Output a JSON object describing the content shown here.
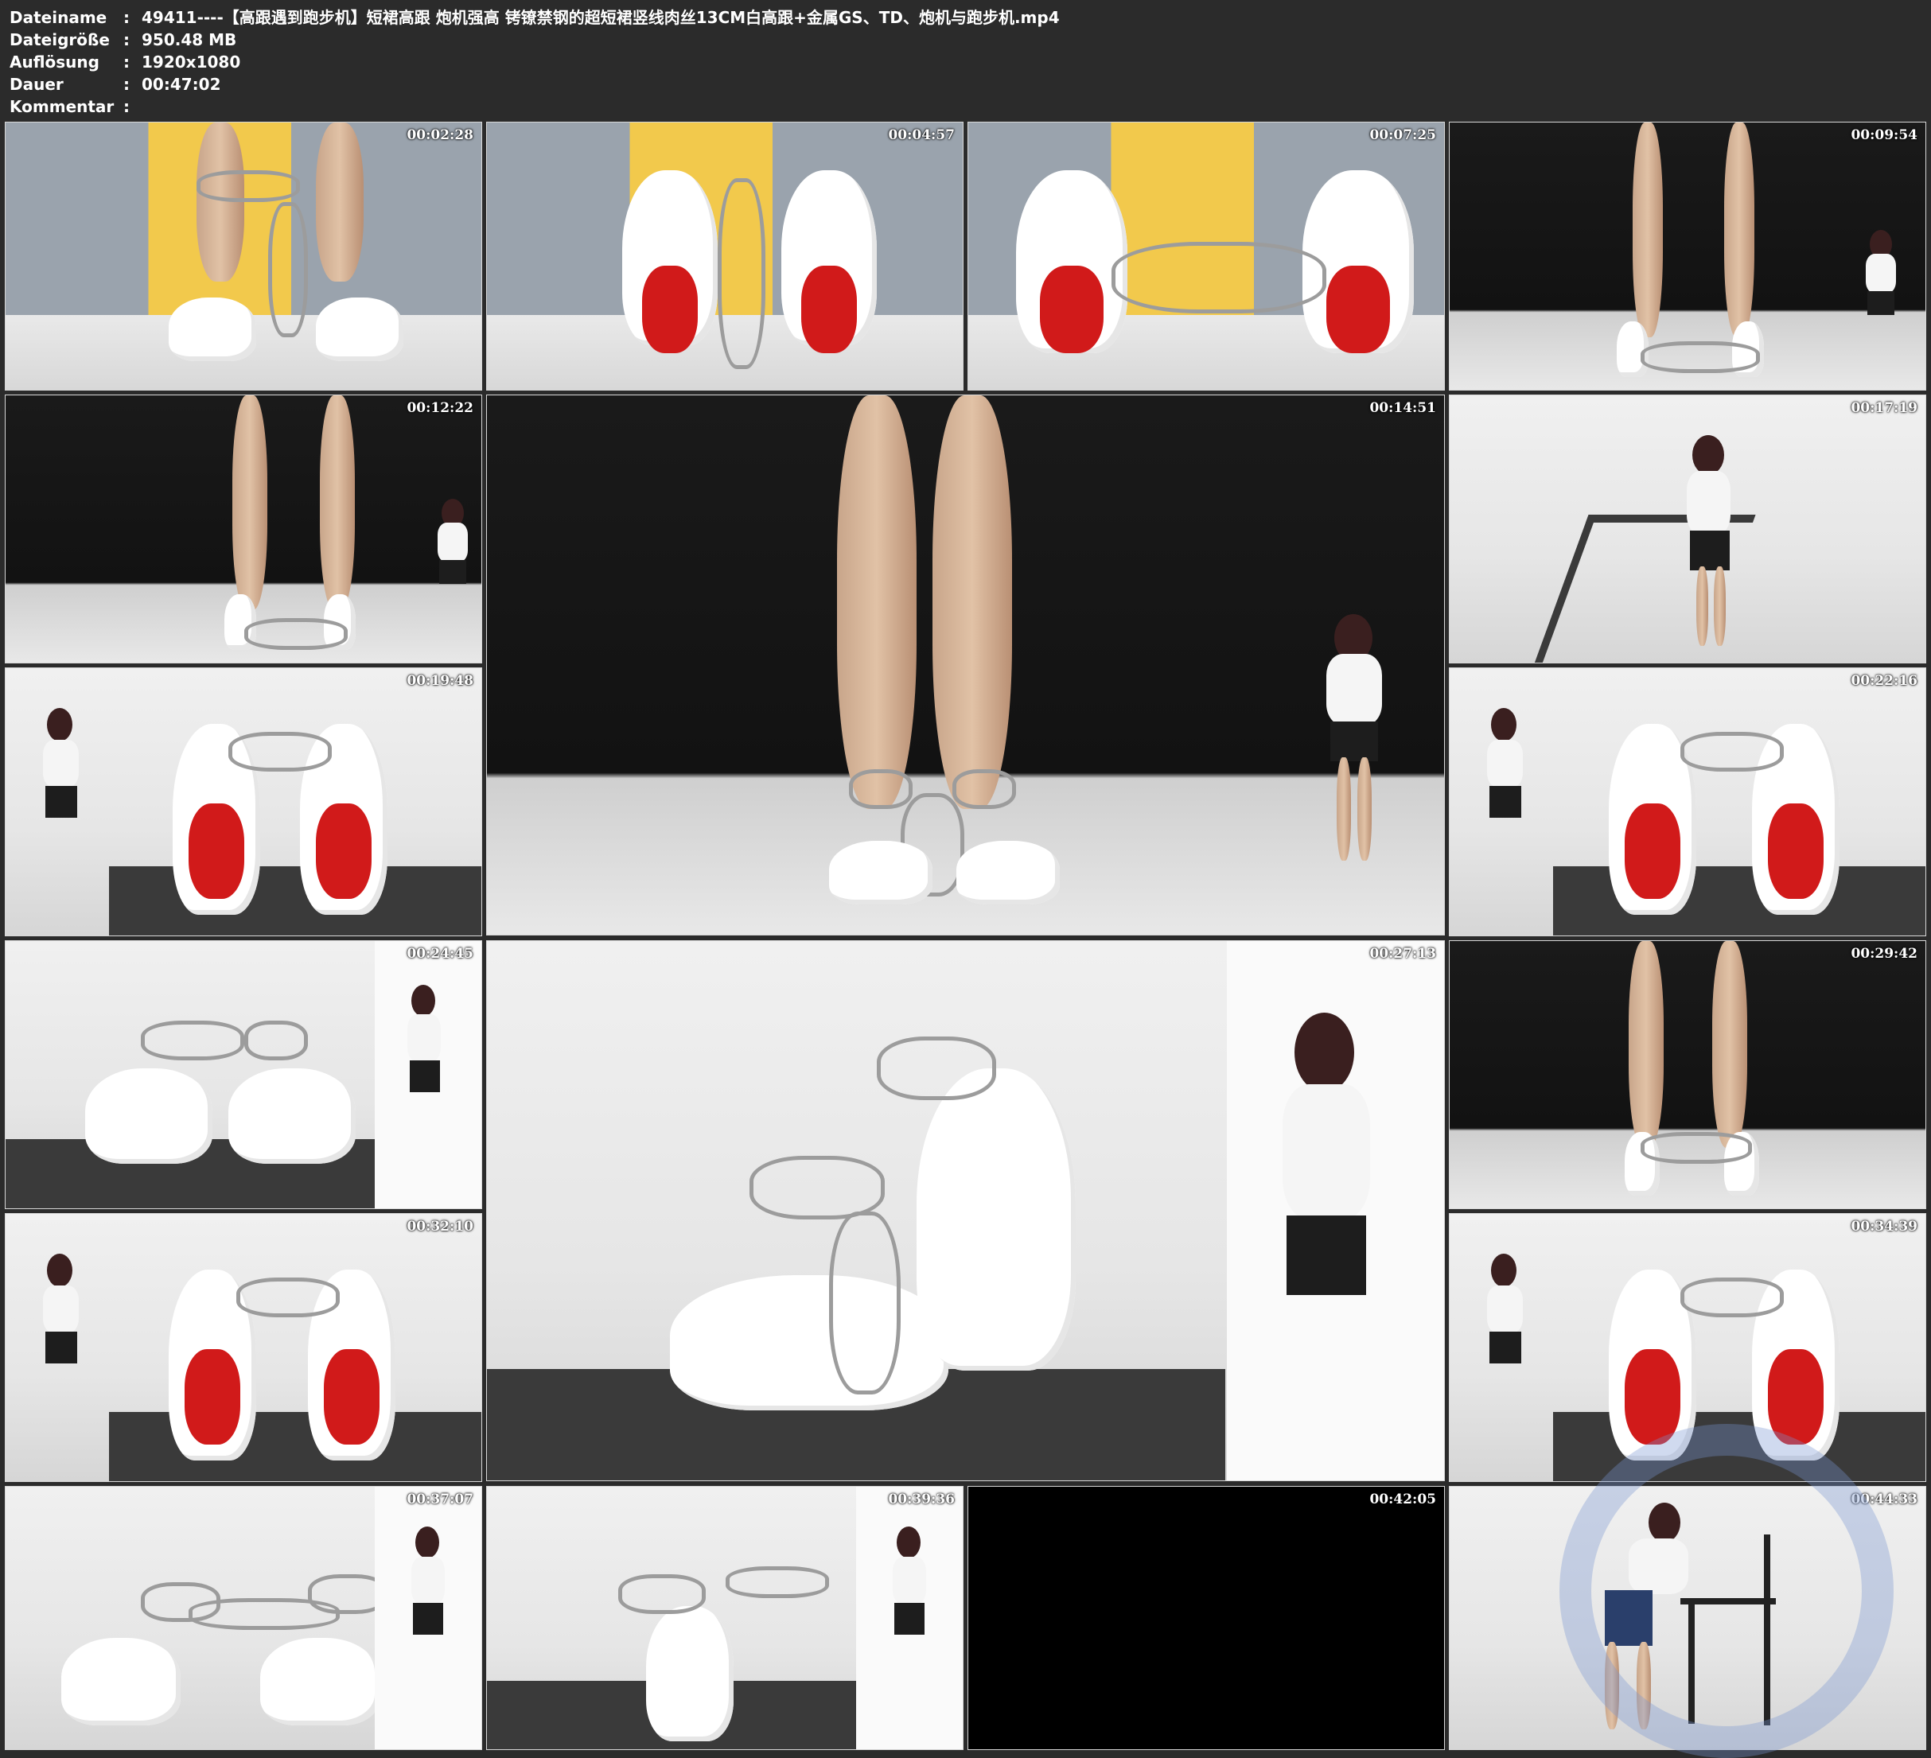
{
  "info": {
    "rows": [
      {
        "label": "Dateiname",
        "value": "49411----【高跟遇到跑步机】短裙高跟 炮机强高 铐镣禁钢的超短裙竖线肉丝13CM白高跟+金属GS、TD、炮机与跑步机.mp4"
      },
      {
        "label": "Dateigröße",
        "value": "950.48 MB"
      },
      {
        "label": "Auflösung",
        "value": "1920x1080"
      },
      {
        "label": "Dauer",
        "value": "00:47:02"
      },
      {
        "label": "Kommentar",
        "value": ""
      }
    ],
    "colon": ":"
  },
  "thumbnails": [
    {
      "time": "00:02:28",
      "scene": "yellow-shoes"
    },
    {
      "time": "00:04:57",
      "scene": "yellow-heels-back"
    },
    {
      "time": "00:07:25",
      "scene": "yellow-heels-back"
    },
    {
      "time": "00:09:54",
      "scene": "dark-legs"
    },
    {
      "time": "00:12:22",
      "scene": "dark-legs"
    },
    {
      "time": "00:14:51",
      "scene": "dark-legs-large"
    },
    {
      "time": "00:17:19",
      "scene": "light-treadmill"
    },
    {
      "time": "00:19:48",
      "scene": "treadmill-heels"
    },
    {
      "time": "00:22:16",
      "scene": "treadmill-heels"
    },
    {
      "time": "00:24:45",
      "scene": "treadmill-shoes"
    },
    {
      "time": "00:27:13",
      "scene": "treadmill-large"
    },
    {
      "time": "00:29:42",
      "scene": "dark-legs"
    },
    {
      "time": "00:32:10",
      "scene": "treadmill-heels"
    },
    {
      "time": "00:34:39",
      "scene": "treadmill-heels"
    },
    {
      "time": "00:37:07",
      "scene": "treadmill-shoes"
    },
    {
      "time": "00:39:36",
      "scene": "treadmill-shoes"
    },
    {
      "time": "00:42:05",
      "scene": "black"
    },
    {
      "time": "00:44:33",
      "scene": "light-chair"
    }
  ]
}
